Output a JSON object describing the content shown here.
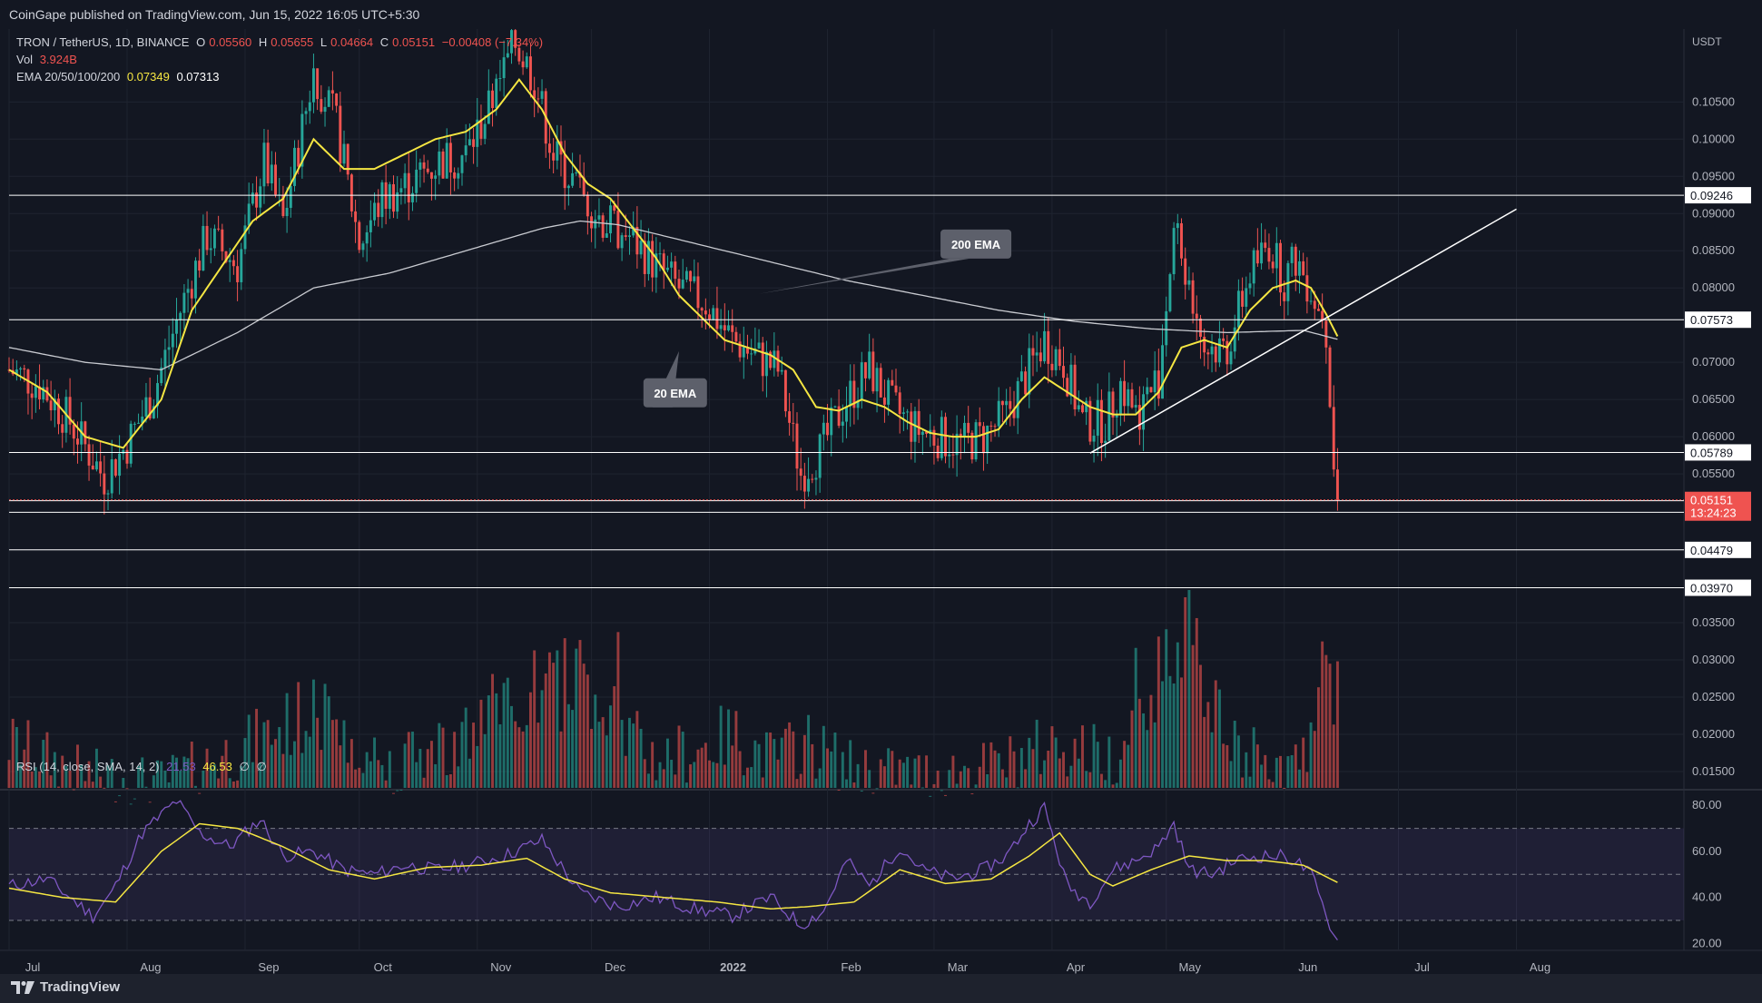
{
  "header": {
    "published": "CoinGape published on TradingView.com, Jun 15, 2022 16:05 UTC+5:30"
  },
  "legend": {
    "symbol": "TRON / TetherUS, 1D, BINANCE",
    "o_label": "O",
    "o_value": "0.05560",
    "h_label": "H",
    "h_value": "0.05655",
    "l_label": "L",
    "l_value": "0.04664",
    "c_label": "C",
    "c_value": "0.05151",
    "change": "−0.00408 (−7.34%)",
    "vol_label": "Vol",
    "vol_value": "3.924B",
    "ema_label": "EMA 20/50/100/200",
    "ema20_value": "0.07349",
    "ema200_value": "0.07313",
    "rsi_label": "RSI (14, close, SMA, 14, 2)",
    "rsi_value": "21.53",
    "rsi_sma_value": "46.53",
    "rsi_extra1": "∅",
    "rsi_extra2": "∅"
  },
  "footer": {
    "brand": "TradingView"
  },
  "colors": {
    "background": "#131722",
    "up": "#26a69a",
    "down": "#ef5350",
    "ema20": "#f5e642",
    "ema200": "#c9cbd1",
    "rsi": "#7e57c2",
    "rsi_sma": "#f5e642",
    "hline": "#ffffff",
    "trendline": "#ffffff"
  },
  "chart_data": {
    "type": "candlestick",
    "currency": "USDT",
    "y_ticks": [
      "0.10500",
      "0.10000",
      "0.09500",
      "0.09000",
      "0.08500",
      "0.08000",
      "0.07000",
      "0.06500",
      "0.06000",
      "0.05500",
      "0.03500",
      "0.03000",
      "0.02500",
      "0.02000",
      "0.01500"
    ],
    "y_tick_values": [
      0.105,
      0.1,
      0.095,
      0.09,
      0.085,
      0.08,
      0.07,
      0.065,
      0.06,
      0.055,
      0.035,
      0.03,
      0.025,
      0.02,
      0.015
    ],
    "ylim": [
      0.0128,
      0.1148
    ],
    "x_labels": [
      "Jul",
      "Aug",
      "Sep",
      "Oct",
      "Nov",
      "Dec",
      "2022",
      "Feb",
      "Mar",
      "Apr",
      "May",
      "Jun",
      "Jul",
      "Aug"
    ],
    "x_label_days": [
      0,
      31,
      62,
      92,
      123,
      153,
      184,
      215,
      243,
      274,
      304,
      335,
      365,
      396
    ],
    "last_day": 349,
    "horizontal_levels": [
      {
        "value": 0.09246,
        "label": "0.09246"
      },
      {
        "value": 0.07573,
        "label": "0.07573"
      },
      {
        "value": 0.05789,
        "label": "0.05789"
      },
      {
        "value": 0.0514,
        "label": "0.05140"
      },
      {
        "value": 0.04985,
        "label": "0.04985"
      },
      {
        "value": 0.04479,
        "label": "0.04479"
      },
      {
        "value": 0.0397,
        "label": "0.03970"
      }
    ],
    "current_price": {
      "value": 0.05151,
      "label": "0.05151",
      "countdown": "13:24:23"
    },
    "trendline": {
      "start": [
        284,
        0.0578
      ],
      "end": [
        396,
        0.0906
      ]
    },
    "annotations": [
      {
        "text": "200 EMA",
        "day": 254,
        "price": 0.0859
      },
      {
        "text": "20 EMA",
        "day": 175,
        "price": 0.0659
      }
    ],
    "price_anchors": [
      [
        0,
        0.069
      ],
      [
        8,
        0.067
      ],
      [
        16,
        0.062
      ],
      [
        25,
        0.0545
      ],
      [
        31,
        0.059
      ],
      [
        38,
        0.066
      ],
      [
        45,
        0.077
      ],
      [
        52,
        0.087
      ],
      [
        60,
        0.083
      ],
      [
        67,
        0.097
      ],
      [
        72,
        0.089
      ],
      [
        80,
        0.109
      ],
      [
        86,
        0.102
      ],
      [
        92,
        0.086
      ],
      [
        98,
        0.092
      ],
      [
        105,
        0.094
      ],
      [
        113,
        0.097
      ],
      [
        120,
        0.098
      ],
      [
        126,
        0.104
      ],
      [
        133,
        0.113
      ],
      [
        138,
        0.108
      ],
      [
        143,
        0.098
      ],
      [
        150,
        0.093
      ],
      [
        156,
        0.089
      ],
      [
        163,
        0.087
      ],
      [
        170,
        0.083
      ],
      [
        176,
        0.08
      ],
      [
        183,
        0.078
      ],
      [
        190,
        0.073
      ],
      [
        196,
        0.071
      ],
      [
        202,
        0.069
      ],
      [
        208,
        0.055
      ],
      [
        213,
        0.058
      ],
      [
        220,
        0.065
      ],
      [
        226,
        0.069
      ],
      [
        232,
        0.064
      ],
      [
        238,
        0.061
      ],
      [
        244,
        0.06
      ],
      [
        250,
        0.059
      ],
      [
        256,
        0.06
      ],
      [
        262,
        0.063
      ],
      [
        268,
        0.069
      ],
      [
        272,
        0.073
      ],
      [
        277,
        0.07
      ],
      [
        282,
        0.062
      ],
      [
        288,
        0.062
      ],
      [
        292,
        0.067
      ],
      [
        296,
        0.063
      ],
      [
        302,
        0.068
      ],
      [
        306,
        0.088
      ],
      [
        310,
        0.081
      ],
      [
        314,
        0.072
      ],
      [
        320,
        0.072
      ],
      [
        326,
        0.082
      ],
      [
        331,
        0.086
      ],
      [
        335,
        0.081
      ],
      [
        338,
        0.084
      ],
      [
        342,
        0.08
      ],
      [
        345,
        0.0756
      ],
      [
        346,
        0.072
      ],
      [
        347,
        0.064
      ],
      [
        348,
        0.0556
      ],
      [
        349,
        0.0515
      ]
    ],
    "ema20_anchors": [
      [
        0,
        0.069
      ],
      [
        10,
        0.066
      ],
      [
        20,
        0.06
      ],
      [
        30,
        0.0585
      ],
      [
        40,
        0.065
      ],
      [
        48,
        0.077
      ],
      [
        56,
        0.083
      ],
      [
        64,
        0.089
      ],
      [
        72,
        0.092
      ],
      [
        80,
        0.1
      ],
      [
        88,
        0.096
      ],
      [
        96,
        0.096
      ],
      [
        104,
        0.098
      ],
      [
        112,
        0.1
      ],
      [
        120,
        0.101
      ],
      [
        128,
        0.104
      ],
      [
        134,
        0.108
      ],
      [
        140,
        0.104
      ],
      [
        146,
        0.098
      ],
      [
        152,
        0.094
      ],
      [
        158,
        0.092
      ],
      [
        164,
        0.088
      ],
      [
        170,
        0.084
      ],
      [
        176,
        0.079
      ],
      [
        182,
        0.076
      ],
      [
        188,
        0.073
      ],
      [
        194,
        0.072
      ],
      [
        200,
        0.071
      ],
      [
        206,
        0.069
      ],
      [
        212,
        0.064
      ],
      [
        218,
        0.0635
      ],
      [
        224,
        0.065
      ],
      [
        230,
        0.064
      ],
      [
        236,
        0.062
      ],
      [
        242,
        0.0605
      ],
      [
        248,
        0.06
      ],
      [
        254,
        0.06
      ],
      [
        260,
        0.061
      ],
      [
        266,
        0.065
      ],
      [
        272,
        0.068
      ],
      [
        278,
        0.066
      ],
      [
        284,
        0.064
      ],
      [
        290,
        0.063
      ],
      [
        296,
        0.063
      ],
      [
        302,
        0.066
      ],
      [
        308,
        0.072
      ],
      [
        314,
        0.073
      ],
      [
        320,
        0.072
      ],
      [
        326,
        0.077
      ],
      [
        332,
        0.08
      ],
      [
        338,
        0.081
      ],
      [
        342,
        0.08
      ],
      [
        346,
        0.0765
      ],
      [
        349,
        0.0735
      ]
    ],
    "ema200_anchors": [
      [
        0,
        0.072
      ],
      [
        20,
        0.07
      ],
      [
        40,
        0.069
      ],
      [
        60,
        0.074
      ],
      [
        80,
        0.08
      ],
      [
        100,
        0.082
      ],
      [
        120,
        0.085
      ],
      [
        140,
        0.088
      ],
      [
        150,
        0.089
      ],
      [
        160,
        0.0885
      ],
      [
        180,
        0.086
      ],
      [
        200,
        0.0835
      ],
      [
        220,
        0.081
      ],
      [
        240,
        0.079
      ],
      [
        260,
        0.077
      ],
      [
        280,
        0.0755
      ],
      [
        300,
        0.0745
      ],
      [
        320,
        0.074
      ],
      [
        340,
        0.0743
      ],
      [
        349,
        0.0731
      ]
    ],
    "volume": {
      "max": 0.0369,
      "anchors": [
        [
          0,
          0.019
        ],
        [
          20,
          0.015
        ],
        [
          40,
          0.014
        ],
        [
          60,
          0.018
        ],
        [
          80,
          0.023
        ],
        [
          100,
          0.016
        ],
        [
          120,
          0.02
        ],
        [
          130,
          0.024
        ],
        [
          140,
          0.026
        ],
        [
          150,
          0.027
        ],
        [
          160,
          0.021
        ],
        [
          170,
          0.017
        ],
        [
          180,
          0.018
        ],
        [
          190,
          0.02
        ],
        [
          200,
          0.017
        ],
        [
          210,
          0.019
        ],
        [
          220,
          0.016
        ],
        [
          240,
          0.015
        ],
        [
          260,
          0.016
        ],
        [
          275,
          0.019
        ],
        [
          290,
          0.017
        ],
        [
          300,
          0.026
        ],
        [
          306,
          0.03
        ],
        [
          310,
          0.034
        ],
        [
          320,
          0.018
        ],
        [
          330,
          0.017
        ],
        [
          340,
          0.016
        ],
        [
          346,
          0.029
        ],
        [
          349,
          0.026
        ]
      ],
      "spikes": [
        [
          80,
          0.0265
        ],
        [
          126,
          0.0245
        ],
        [
          150,
          0.0315
        ],
        [
          160,
          0.0325
        ],
        [
          296,
          0.0305
        ],
        [
          307,
          0.0312
        ],
        [
          309,
          0.0369
        ],
        [
          346,
          0.0296
        ],
        [
          347,
          0.0285
        ]
      ]
    },
    "rsi": {
      "ticks": [
        "80.00",
        "60.00",
        "40.00",
        "20.00"
      ],
      "tick_values": [
        80,
        60,
        40,
        20
      ],
      "upper": 70,
      "mid": 50,
      "lower": 30,
      "ylim": [
        17,
        86
      ],
      "anchors": [
        [
          0,
          45
        ],
        [
          10,
          48
        ],
        [
          22,
          32
        ],
        [
          27,
          42
        ],
        [
          35,
          68
        ],
        [
          44,
          82
        ],
        [
          50,
          68
        ],
        [
          58,
          62
        ],
        [
          66,
          74
        ],
        [
          72,
          58
        ],
        [
          80,
          60
        ],
        [
          88,
          52
        ],
        [
          96,
          50
        ],
        [
          104,
          54
        ],
        [
          112,
          52
        ],
        [
          120,
          54
        ],
        [
          130,
          58
        ],
        [
          140,
          65
        ],
        [
          150,
          42
        ],
        [
          160,
          36
        ],
        [
          170,
          40
        ],
        [
          180,
          35
        ],
        [
          190,
          32
        ],
        [
          200,
          40
        ],
        [
          208,
          28
        ],
        [
          214,
          34
        ],
        [
          220,
          56
        ],
        [
          226,
          45
        ],
        [
          234,
          62
        ],
        [
          240,
          52
        ],
        [
          248,
          48
        ],
        [
          256,
          52
        ],
        [
          262,
          58
        ],
        [
          268,
          72
        ],
        [
          272,
          79
        ],
        [
          278,
          45
        ],
        [
          284,
          38
        ],
        [
          290,
          52
        ],
        [
          296,
          56
        ],
        [
          302,
          62
        ],
        [
          306,
          72
        ],
        [
          310,
          52
        ],
        [
          316,
          50
        ],
        [
          322,
          56
        ],
        [
          328,
          58
        ],
        [
          334,
          58
        ],
        [
          338,
          56
        ],
        [
          342,
          50
        ],
        [
          345,
          38
        ],
        [
          347,
          26
        ],
        [
          349,
          21.5
        ]
      ],
      "sma_anchors": [
        [
          0,
          44
        ],
        [
          14,
          40
        ],
        [
          28,
          38
        ],
        [
          40,
          60
        ],
        [
          50,
          72
        ],
        [
          60,
          70
        ],
        [
          72,
          62
        ],
        [
          84,
          52
        ],
        [
          96,
          48
        ],
        [
          110,
          53
        ],
        [
          124,
          54
        ],
        [
          136,
          57
        ],
        [
          146,
          48
        ],
        [
          158,
          42
        ],
        [
          172,
          40
        ],
        [
          186,
          38
        ],
        [
          200,
          35
        ],
        [
          210,
          36
        ],
        [
          222,
          38
        ],
        [
          234,
          52
        ],
        [
          246,
          46
        ],
        [
          258,
          48
        ],
        [
          268,
          58
        ],
        [
          276,
          68
        ],
        [
          284,
          50
        ],
        [
          290,
          45
        ],
        [
          300,
          52
        ],
        [
          310,
          58
        ],
        [
          320,
          56
        ],
        [
          330,
          56
        ],
        [
          340,
          54
        ],
        [
          349,
          46.5
        ]
      ]
    }
  }
}
